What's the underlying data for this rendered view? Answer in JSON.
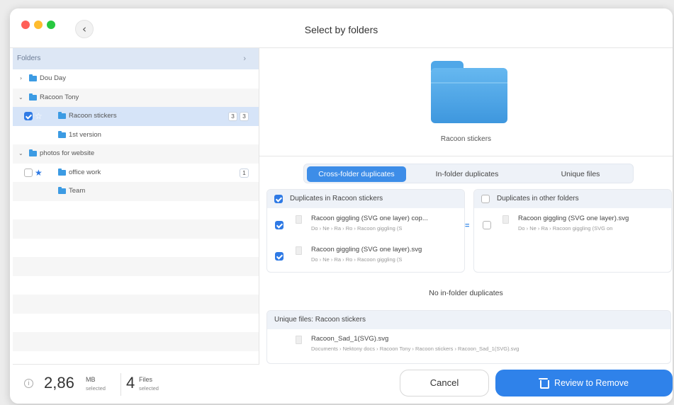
{
  "window": {
    "title": "Select by folders",
    "back_icon": "‹"
  },
  "sidebar": {
    "header": "Folders",
    "header_chevron": "›",
    "rows": [
      {
        "label": "Dou Day",
        "twisty": "›"
      },
      {
        "label": "Racoon Tony",
        "twisty": "⌄"
      },
      {
        "label": "Racoon stickers",
        "checked": true,
        "starred": false,
        "count_a": "3",
        "count_b": "3"
      },
      {
        "label": "1st version"
      },
      {
        "label": "photos for website",
        "twisty": "⌄"
      },
      {
        "label": "office work",
        "checked": false,
        "starred": true,
        "count_a": "1"
      },
      {
        "label": "Team"
      }
    ]
  },
  "footer": {
    "size_value": "2,86",
    "size_unit": "MB",
    "size_sub": "selected",
    "files_value": "4",
    "files_unit": "Files",
    "files_sub": "selected",
    "info_icon": "i"
  },
  "preview": {
    "folder_name": "Racoon stickers"
  },
  "tabs": [
    {
      "label": "Cross-folder duplicates",
      "active": true
    },
    {
      "label": "In-folder duplicates",
      "active": false
    },
    {
      "label": "Unique files",
      "active": false
    }
  ],
  "left_panel": {
    "header": "Duplicates in Racoon stickers",
    "items": [
      {
        "name": "Racoon giggling (SVG one layer) cop...",
        "path": "Do › Ne › Ra › Ro › Racoon giggling (S",
        "checked": true
      },
      {
        "name": "Racoon giggling (SVG one layer).svg",
        "path": "Do › Ne › Ra › Ro › Racoon giggling (S",
        "checked": true
      }
    ]
  },
  "right_panel": {
    "header": "Duplicates in other folders",
    "items": [
      {
        "name": "Racoon giggling (SVG one layer).svg",
        "path": "Do › Ne › Ra › Racoon giggling (SVG on",
        "checked": false
      }
    ]
  },
  "equals": "=",
  "no_in_folder": "No in-folder duplicates",
  "unique": {
    "header": "Unique files: Racoon stickers",
    "items": [
      {
        "name": "Racoon_Sad_1(SVG).svg",
        "path": "Documents › Nektony docs › Racoon Tony › Racoon stickers › Racoon_Sad_1(SVG).svg"
      }
    ]
  },
  "buttons": {
    "cancel": "Cancel",
    "review": "Review to Remove"
  },
  "colors": {
    "accent": "#2f82ea",
    "folder": "#3c9be3",
    "close": "#ff5f57",
    "minimize": "#febc2e",
    "zoom": "#28c840"
  }
}
